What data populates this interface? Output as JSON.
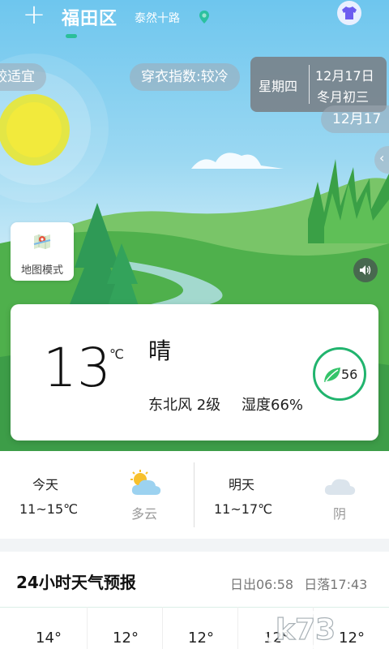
{
  "header": {
    "add_icon": "plus-icon",
    "city": "福田区",
    "street": "泰然十路",
    "location_icon": "location-pin-icon",
    "outfit_icon": "shirt-icon"
  },
  "pills": {
    "comfort": "较适宜",
    "dress_index": "穿衣指数:较冷",
    "date_second": "12月17"
  },
  "date_card": {
    "weekday": "星期四",
    "date": "12月17日",
    "lunar": "冬月初三"
  },
  "map_mode": {
    "label": "地图模式",
    "icon": "map-icon"
  },
  "sound_icon": "speaker-icon",
  "current": {
    "temperature": "13",
    "unit": "℃",
    "condition": "晴",
    "wind": "东北风 2级",
    "humidity": "湿度66%",
    "aqi": "56",
    "aqi_color": "#21b46e"
  },
  "days": [
    {
      "title": "今天",
      "range": "11~15℃",
      "condition": "多云",
      "icon": "partly-cloudy-icon"
    },
    {
      "title": "明天",
      "range": "11~17℃",
      "condition": "阴",
      "icon": "cloud-icon"
    }
  ],
  "forecast": {
    "title": "24小时天气预报",
    "sunrise": "日出06:58",
    "sunset": "日落17:43",
    "temps": [
      "14°",
      "12°",
      "12°",
      "12°",
      "12°"
    ]
  },
  "watermark": "k73",
  "colors": {
    "accent": "#2bbf9a",
    "sky_top": "#6ec6ee",
    "hill": "#3faa4c"
  }
}
